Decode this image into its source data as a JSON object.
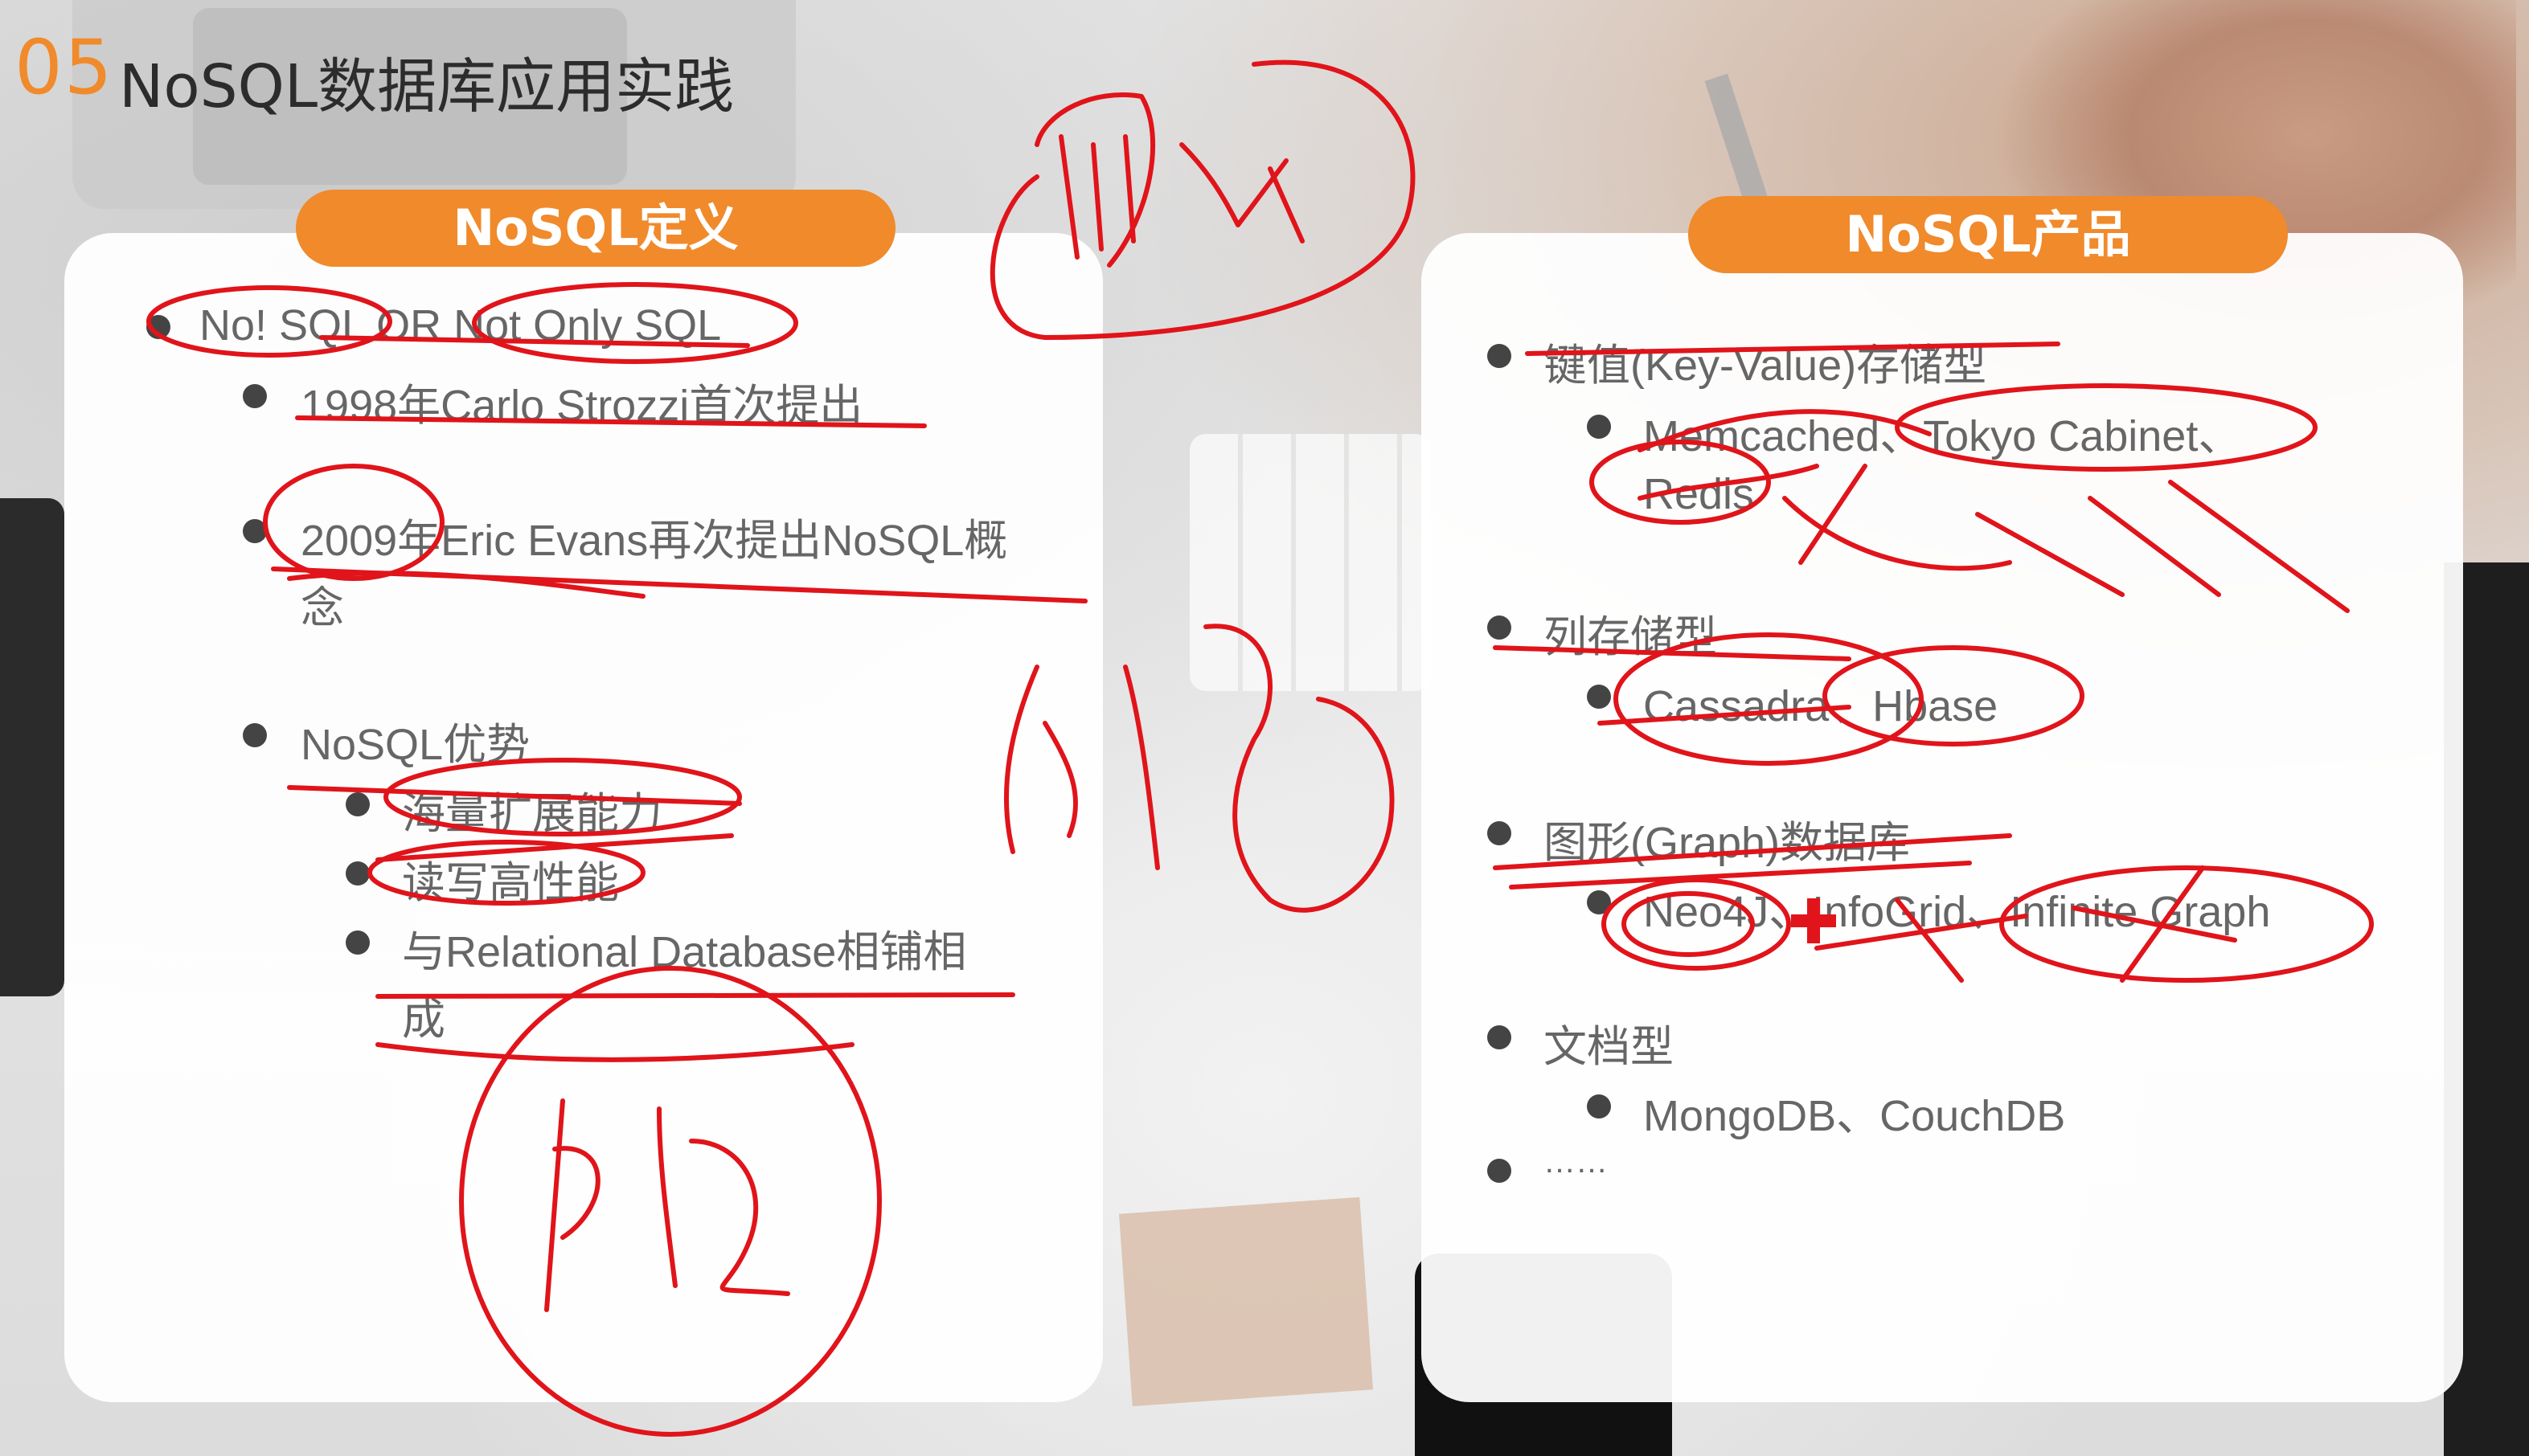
{
  "slide": {
    "number": "05",
    "title": "NoSQL数据库应用实践"
  },
  "left_panel": {
    "header": "NoSQL定义",
    "items": [
      "No! SQL OR Not Only SQL",
      "1998年Carlo Strozzi首次提出",
      "2009年Eric Evans再次提出NoSQL概",
      "念",
      "NoSQL优势",
      "海量扩展能力",
      "读写高性能",
      "与Relational Database相铺相",
      "成"
    ]
  },
  "right_panel": {
    "header": "NoSQL产品",
    "items": [
      "键值(Key-Value)存储型",
      "Memcached、Tokyo Cabinet、",
      "Redis",
      "列存储型",
      "Cassadra、Hbase",
      "图形(Graph)数据库",
      "Neo4J、InfoGrid、Infinite Graph",
      "文档型",
      "MongoDB、CouchDB",
      "……"
    ]
  },
  "colors": {
    "accent": "#f08a2b",
    "annotation": "#e0141a",
    "text": "#666666"
  },
  "icons": {
    "cursor": "red-crosshair-cursor-icon"
  }
}
